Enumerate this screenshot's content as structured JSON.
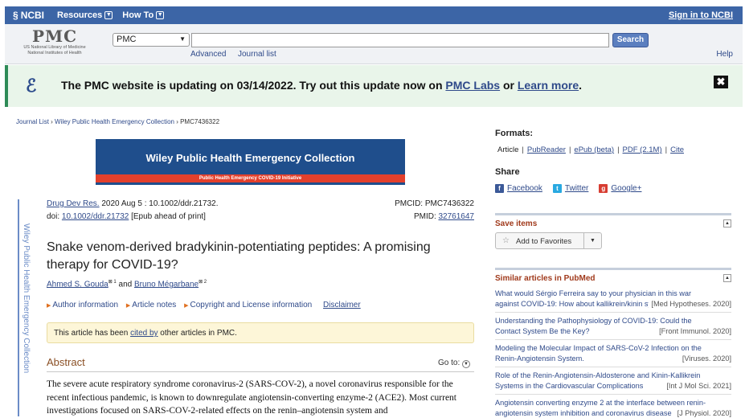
{
  "ncbi_bar": {
    "logo": "NCBI",
    "resources": "Resources",
    "howto": "How To",
    "signin": "Sign in to NCBI"
  },
  "pmc_header": {
    "logo_big": "PMC",
    "logo_line1": "US National Library of Medicine",
    "logo_line2": "National Institutes of Health",
    "db_value": "PMC",
    "search_value": "",
    "search_button": "Search",
    "advanced": "Advanced",
    "journal_list": "Journal list",
    "help": "Help"
  },
  "banner": {
    "text_a": "The PMC website is updating on 03/14/2022. Try out this update now on ",
    "link1": "PMC Labs",
    "text_b": " or ",
    "link2": "Learn more",
    "text_c": ".",
    "close": "✖"
  },
  "breadcrumb": {
    "items": [
      "Journal List",
      "Wiley Public Health Emergency Collection",
      "PMC7436322"
    ],
    "sep": " › "
  },
  "collection_banner": {
    "title": "Wiley Public Health Emergency Collection",
    "ribbon": "Public Health Emergency COVID-19 Initiative"
  },
  "vertical_label": "Wiley Public Health Emergency Collection",
  "citation": {
    "journal": "Drug Dev Res.",
    "info": " 2020 Aug 5 : 10.1002/ddr.21732.",
    "doi_label": "doi: ",
    "doi": "10.1002/ddr.21732",
    "epub": " [Epub ahead of print]",
    "pmcid": "PMCID: PMC7436322",
    "pmid_label": "PMID: ",
    "pmid": "32761647"
  },
  "article": {
    "title": "Snake venom-derived bradykinin-potentiating peptides: A promising therapy for COVID-19?",
    "author1": "Ahmed S. Gouda",
    "author1_sup": "1",
    "and": " and ",
    "author2": "Bruno Mégarbane",
    "author2_sup": "2",
    "info_links": [
      "Author information",
      "Article notes",
      "Copyright and License information"
    ],
    "disclaimer": "Disclaimer",
    "cited_a": "This article has been ",
    "cited_link": "cited by",
    "cited_b": " other articles in PMC."
  },
  "abstract": {
    "heading": "Abstract",
    "goto": "Go to:",
    "text": "The severe acute respiratory syndrome coronavirus-2 (SARS-COV-2), a novel coronavirus responsible for the recent infectious pandemic, is known to downregulate angiotensin-converting enzyme-2 (ACE2). Most current investigations focused on SARS-COV-2-related effects on the renin–angiotensin system and"
  },
  "sidebar": {
    "formats_heading": "Formats:",
    "formats": [
      "Article",
      "PubReader",
      "ePub (beta)",
      "PDF (2.1M)",
      "Cite"
    ],
    "share_heading": "Share",
    "share": [
      "Facebook",
      "Twitter",
      "Google+"
    ],
    "save_heading": "Save items",
    "add_favorites": "Add to Favorites",
    "similar_heading": "Similar articles in PubMed",
    "similar": [
      {
        "line1": "What would Sérgio Ferreira say to your physician in this war",
        "line2": "against COVID-19: How about kallikrein/kinin system?",
        "source": "[Med Hypotheses. 2020]"
      },
      {
        "line1": "Understanding the Pathophysiology of COVID-19: Could the",
        "line2": "Contact System Be the Key?",
        "source": "[Front Immunol. 2020]"
      },
      {
        "line1": "Modeling the Molecular Impact of SARS-CoV-2 Infection on the",
        "line2": "Renin-Angiotensin System.",
        "source": "[Viruses. 2020]"
      },
      {
        "line1": "Role of the Renin-Angiotensin-Aldosterone and Kinin-Kallikrein",
        "line2": "Systems in the Cardiovascular Complications",
        "source": "[Int J Mol Sci. 2021]"
      },
      {
        "line1": "Angiotensin converting enzyme 2 at the interface between renin-",
        "line2": "angiotensin system inhibition and coronavirus disease",
        "source": "[J Physiol. 2020]"
      }
    ]
  },
  "colors": {
    "ncbi_blue": "#3c65a6",
    "banner_green": "#e9f5ea",
    "collection_blue": "#1f4e8c",
    "ribbon_red": "#e3402c"
  }
}
